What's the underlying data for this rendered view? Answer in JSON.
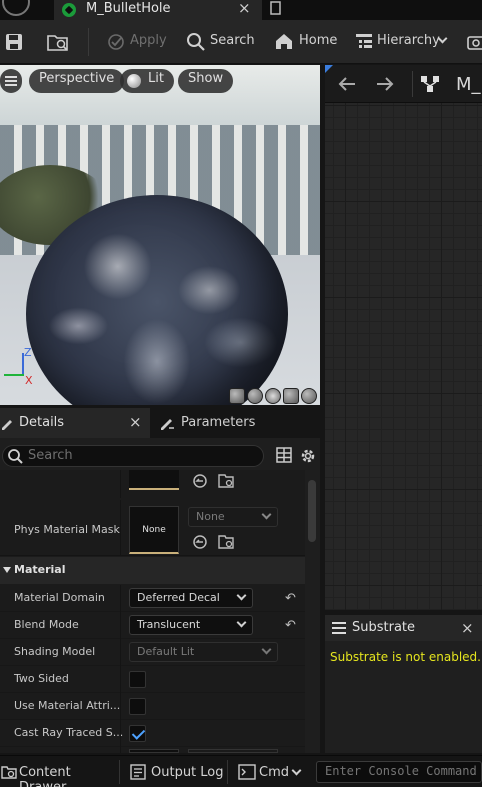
{
  "titlebar": {
    "tab_title": "M_BulletHole",
    "close": "×"
  },
  "toolbar": {
    "apply_label": "Apply",
    "search_label": "Search",
    "home_label": "Home",
    "hierarchy_label": "Hierarchy"
  },
  "viewport": {
    "perspective_label": "Perspective",
    "lit_label": "Lit",
    "show_label": "Show",
    "axis_z": "Z",
    "axis_x": "X"
  },
  "details": {
    "tab_details": "Details",
    "tab_details_close": "×",
    "tab_parameters": "Parameters",
    "search_placeholder": "Search",
    "phys_material_mask_label": "Phys Material Mask",
    "phys_thumb_none": "None",
    "phys_combo_value": "None",
    "section_material": "Material",
    "rows": [
      {
        "label": "Material Domain",
        "value": "Deferred Decal"
      },
      {
        "label": "Blend Mode",
        "value": "Translucent"
      },
      {
        "label": "Shading Model",
        "value": "Default Lit"
      },
      {
        "label": "Two Sided",
        "checked": false
      },
      {
        "label": "Use Material Attri...",
        "checked": false
      },
      {
        "label": "Cast Ray Traced S...",
        "checked": true
      }
    ]
  },
  "graph": {
    "title": "M_"
  },
  "substrate": {
    "title": "Substrate",
    "close": "×",
    "message": "Substrate is not enabled."
  },
  "bottombar": {
    "content_drawer": "Content Drawer",
    "output_log": "Output Log",
    "cmd": "Cmd",
    "console_placeholder": "Enter Console Command"
  },
  "colors": {
    "accent_check": "#4ea2ff",
    "substrate_message": "#e5e51f",
    "asset_green": "#1b9b3a"
  }
}
